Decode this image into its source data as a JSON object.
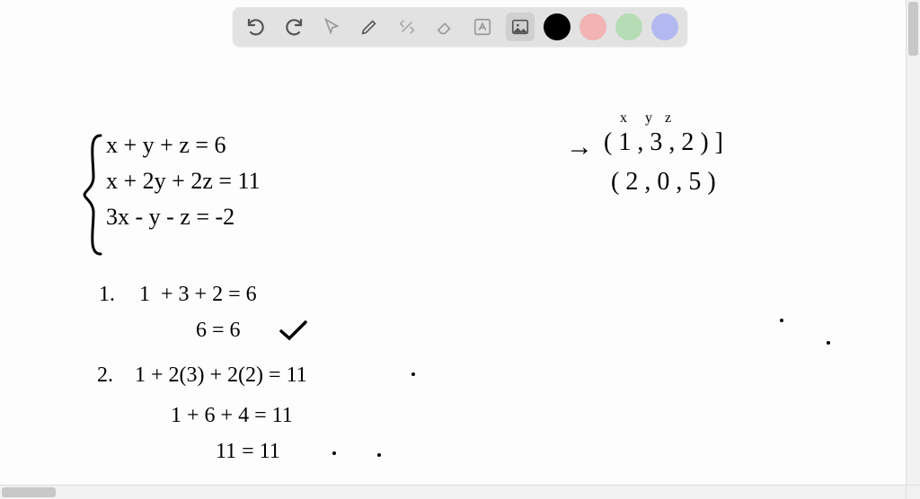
{
  "toolbar": {
    "tools": {
      "undo": "undo",
      "redo": "redo",
      "pointer": "pointer",
      "pencil": "pencil",
      "tools_gear": "edit-tools",
      "eraser": "eraser",
      "text": "text",
      "image": "image"
    },
    "colors": {
      "black": "#000000",
      "pink": "#f1b3b3",
      "green": "#b6dcb6",
      "blue": "#b3b9f0"
    },
    "active_tool": "image",
    "active_color": "black"
  },
  "equations": {
    "eq1": "x + y + z = 6",
    "eq2": "x + 2y + 2z = 11",
    "eq3": "3x - y - z = -2"
  },
  "labels": {
    "xyz": "x   y  z"
  },
  "solutions": {
    "arrow": "→",
    "sol1": "( 1 , 3 , 2 ) ]",
    "sol2": "( 2 , 0 , 5 )"
  },
  "work": {
    "step1_num": "1.",
    "step1_line1": "1  + 3 + 2 = 6",
    "step1_line2": "6 = 6",
    "step2_num": "2.",
    "step2_line1": "1 + 2(3) + 2(2) = 11",
    "step2_line2": "1 + 6 + 4 = 11",
    "step2_line3": "11 = 11"
  }
}
